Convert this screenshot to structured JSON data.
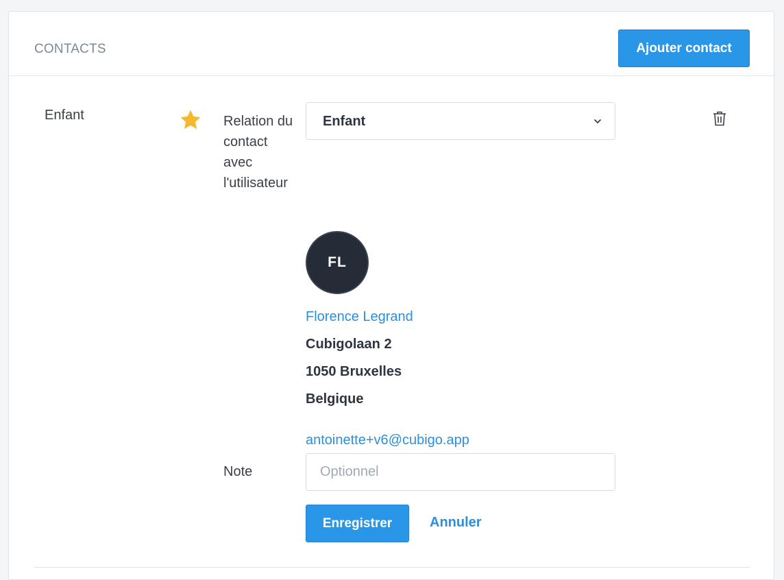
{
  "header": {
    "title": "CONTACTS",
    "add_button_label": "Ajouter contact"
  },
  "contact": {
    "type_label": "Enfant",
    "favorite_icon": "star-icon",
    "relation_label": "Relation du contact avec l'utilisateur",
    "relation_value": "Enfant",
    "avatar_initials": "FL",
    "name": "Florence Legrand",
    "address_line1": "Cubigolaan 2",
    "address_line2": "1050 Bruxelles",
    "address_line3": "Belgique",
    "email": "antoinette+v6@cubigo.app",
    "note_label": "Note",
    "note_value": "",
    "note_placeholder": "Optionnel",
    "save_label": "Enregistrer",
    "cancel_label": "Annuler"
  },
  "colors": {
    "accent": "#2a96e8",
    "link": "#2a8fdc",
    "star": "#f5b82e",
    "avatar_bg": "#262b38"
  }
}
